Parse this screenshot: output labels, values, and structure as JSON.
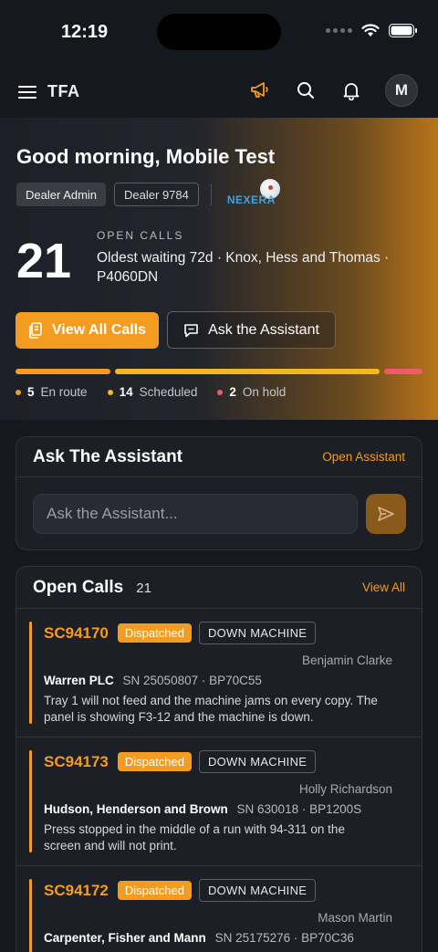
{
  "status_bar": {
    "time": "12:19"
  },
  "header": {
    "brand": "TFA",
    "avatar_initial": "M"
  },
  "hero": {
    "greeting": "Good morning, Mobile Test",
    "role_chip": "Dealer Admin",
    "dealer_chip": "Dealer 9784",
    "logo_text": "NEXERA",
    "open_calls_label": "OPEN CALLS",
    "open_calls_count": "21",
    "oldest_text": "Oldest waiting 72d · Knox, Hess and Thomas · P4060DN",
    "view_all_button": "View All Calls",
    "ask_button": "Ask the Assistant",
    "breakdown": [
      {
        "count": "5",
        "label": "En route",
        "color": "#f39c1f",
        "value": 5
      },
      {
        "count": "14",
        "label": "Scheduled",
        "color": "#f2b824",
        "value": 14
      },
      {
        "count": "2",
        "label": "On hold",
        "color": "#ef5b6b",
        "value": 2
      }
    ]
  },
  "assistant_card": {
    "title": "Ask The Assistant",
    "link": "Open Assistant",
    "placeholder": "Ask the Assistant..."
  },
  "calls_card": {
    "title": "Open Calls",
    "count": "21",
    "link": "View All",
    "calls": [
      {
        "id": "SC94170",
        "status": "Dispatched",
        "type": "DOWN MACHINE",
        "assignee": "Benjamin Clarke",
        "customer": "Warren PLC",
        "meta": "SN 25050807 · BP70C55",
        "description": "Tray 1 will not feed and the machine jams on every copy. The panel is showing F3-12 and the machine is down."
      },
      {
        "id": "SC94173",
        "status": "Dispatched",
        "type": "DOWN MACHINE",
        "assignee": "Holly Richardson",
        "customer": "Hudson, Henderson and Brown",
        "meta": "SN 630018 · BP1200S",
        "description": "Press stopped in the middle of a run with 94-311 on the screen and will not print."
      },
      {
        "id": "SC94172",
        "status": "Dispatched",
        "type": "DOWN MACHINE",
        "assignee": "Mason Martin",
        "customer": "Carpenter, Fisher and Mann",
        "meta": "SN 25175276 · BP70C36",
        "description": ""
      }
    ]
  },
  "colors": {
    "accent": "#f39c1f",
    "background": "#15181e",
    "card": "#1c1f26"
  }
}
